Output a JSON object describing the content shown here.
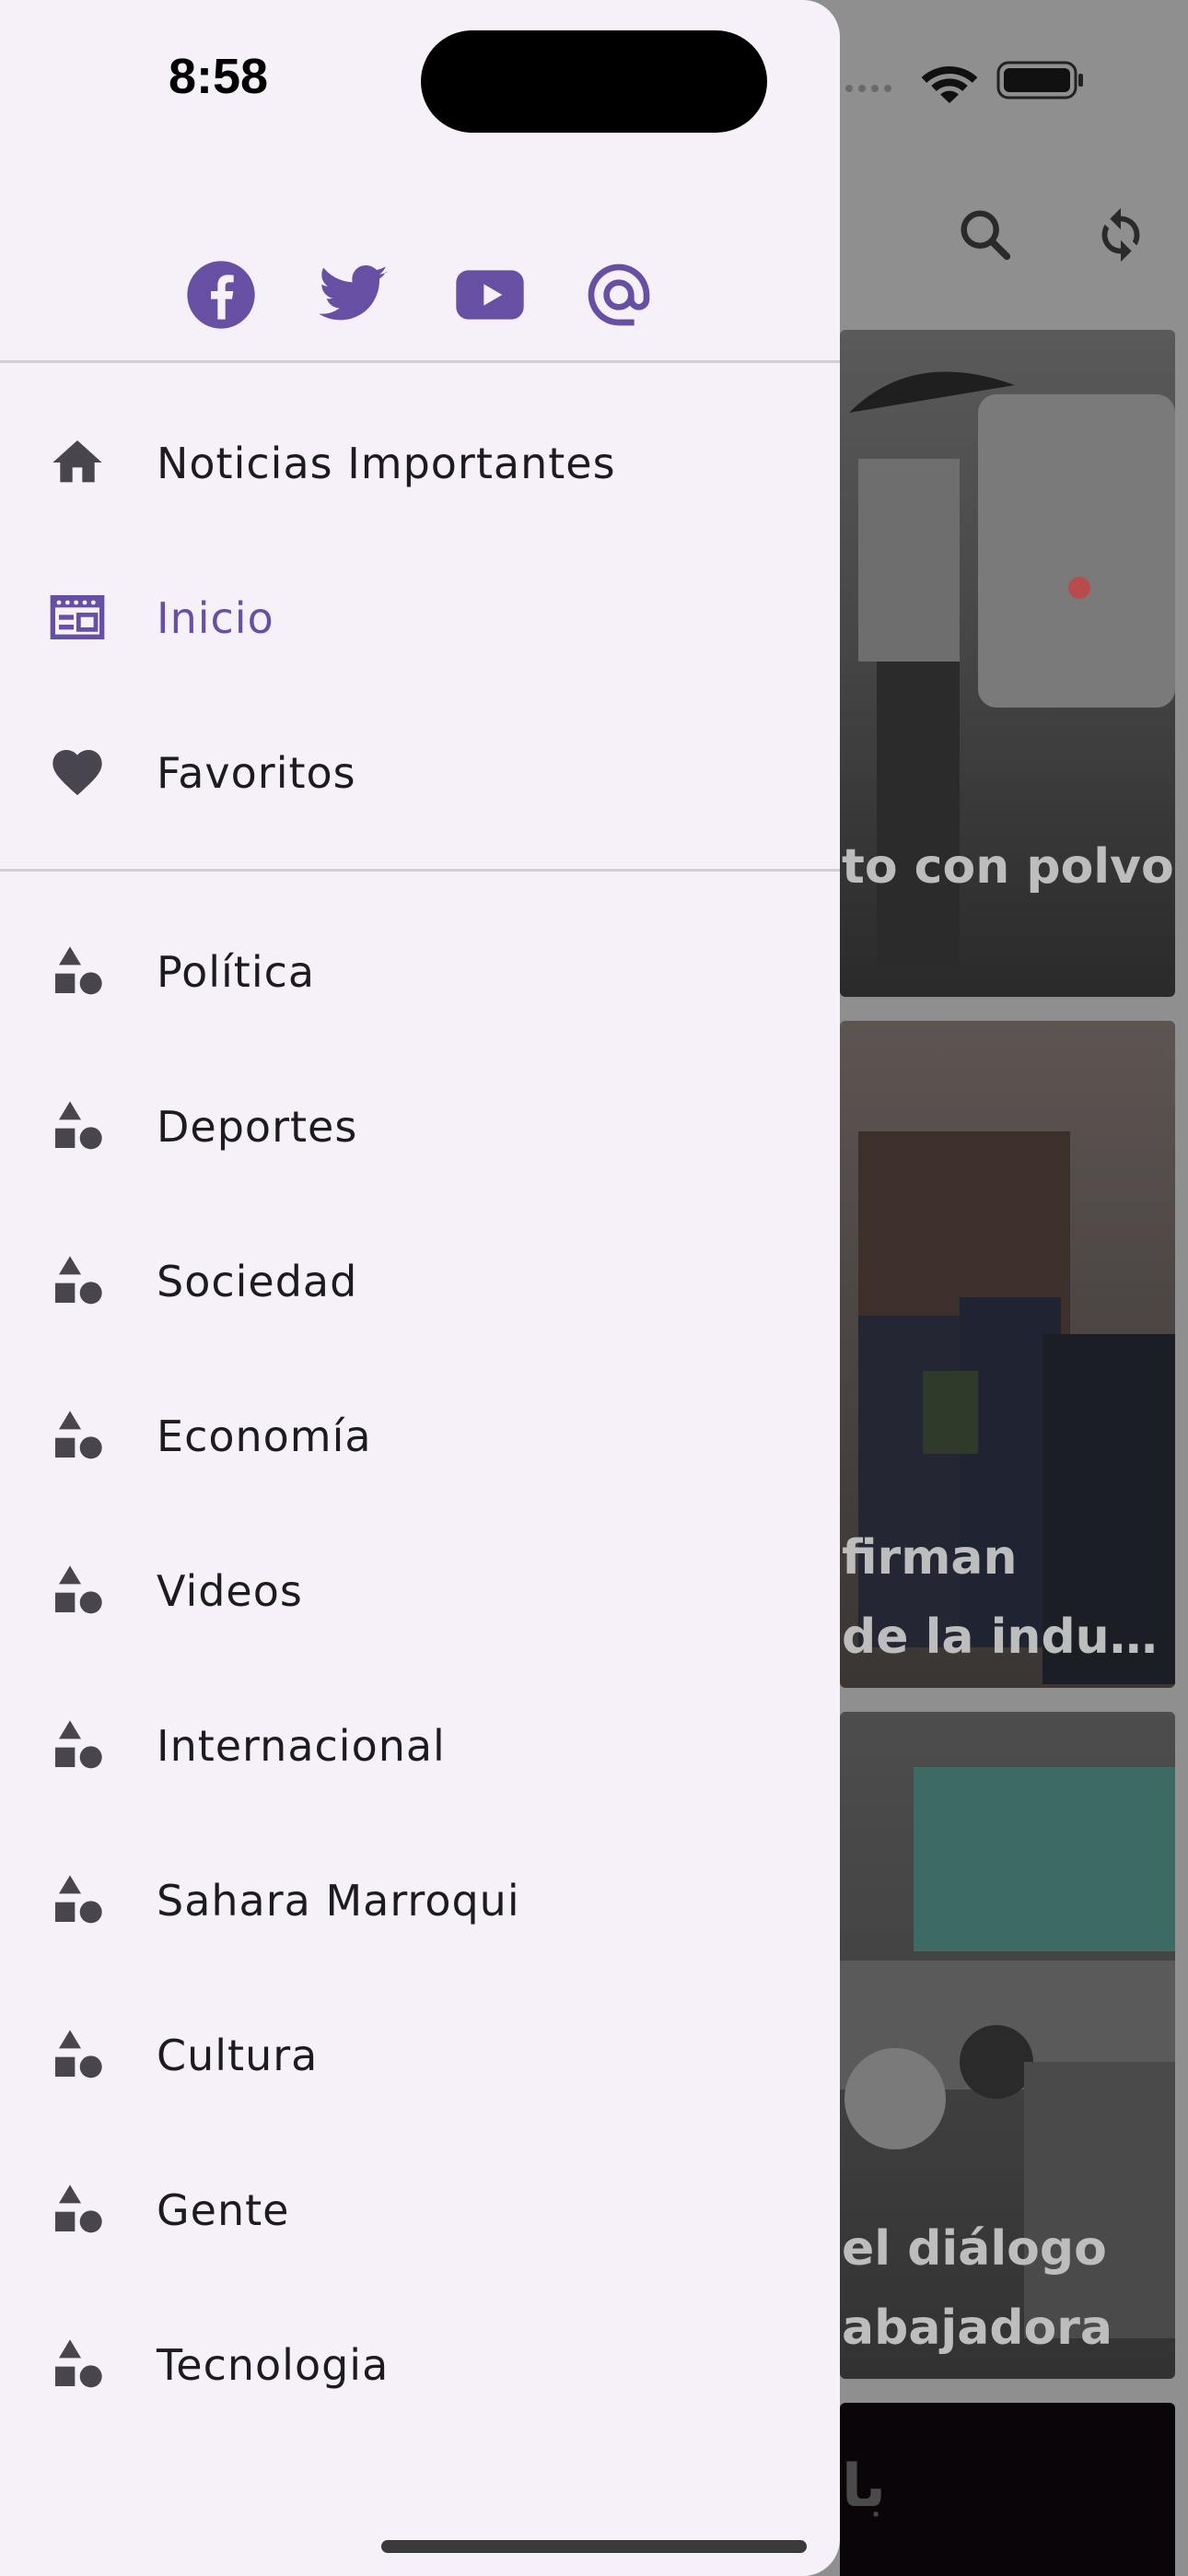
{
  "status_bar": {
    "time": "8:58"
  },
  "colors": {
    "accent": "#6750a4",
    "drawer_bg": "#f6f1f9",
    "icon_dark": "#49454f",
    "text": "#1d1b20"
  },
  "social_icons": [
    "facebook-icon",
    "twitter-icon",
    "youtube-icon",
    "email-at-icon"
  ],
  "menu_primary": [
    {
      "label": "Noticias Importantes",
      "icon": "home-icon"
    },
    {
      "label": "Inicio",
      "icon": "newspaper-icon",
      "active": true
    },
    {
      "label": "Favoritos",
      "icon": "heart-icon"
    }
  ],
  "menu_categories": [
    {
      "label": "Política",
      "icon": "category-icon"
    },
    {
      "label": "Deportes",
      "icon": "category-icon"
    },
    {
      "label": "Sociedad",
      "icon": "category-icon"
    },
    {
      "label": "Economía",
      "icon": "category-icon"
    },
    {
      "label": "Videos",
      "icon": "category-icon"
    },
    {
      "label": "Internacional",
      "icon": "category-icon"
    },
    {
      "label": "Sahara Marroqui",
      "icon": "category-icon"
    },
    {
      "label": "Cultura",
      "icon": "category-icon"
    },
    {
      "label": "Gente",
      "icon": "category-icon"
    },
    {
      "label": "Tecnologia",
      "icon": "category-icon"
    }
  ],
  "background_feed": {
    "cards": [
      {
        "title_lines": [
          "to con polvo"
        ]
      },
      {
        "title_lines": [
          "firman",
          "de la indus…"
        ]
      },
      {
        "title_lines": [
          "el diálogo",
          "abajadora"
        ]
      },
      {
        "title_lines": [
          "با"
        ]
      }
    ]
  }
}
